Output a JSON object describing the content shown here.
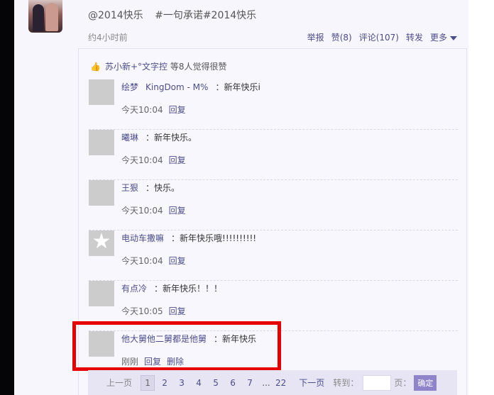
{
  "post": {
    "text_tag1": "@2014快乐",
    "text_tag2": "#一句承诺#2014快乐",
    "time": "约4小时前",
    "actions": {
      "report": "举报",
      "like": "赞(8)",
      "comment": "评论(107)",
      "forward": "转发",
      "more": "更多"
    }
  },
  "likes": {
    "user": "苏小新+°文字控",
    "suffix": " 等8人觉得很赞"
  },
  "comments": [
    {
      "name": "绘梦",
      "name2": "KingDom - M%",
      "text": "：新年快乐i",
      "time": "今天10:04",
      "reply": "回复"
    },
    {
      "name": "曦琳",
      "text": "：新年快乐。",
      "time": "今天10:04",
      "reply": "回复"
    },
    {
      "name": "王狠",
      "text": "：快乐。",
      "time": "今天10:04",
      "reply": "回复"
    },
    {
      "name": "电动车撒嘛",
      "text": "：新年快乐哦!!!!!!!!!!",
      "time": "今天10:04",
      "reply": "回复"
    },
    {
      "name": "有点冷",
      "text": "：新年快乐！！！",
      "time": "今天10:05",
      "reply": "回复"
    },
    {
      "name": "他大舅他二舅都是他舅",
      "text": "：新年快乐",
      "time": "刚刚",
      "reply": "回复",
      "delete": "删除"
    }
  ],
  "pager": {
    "prev": "上一页",
    "pages": [
      "1",
      "2",
      "3",
      "4",
      "5",
      "6",
      "7"
    ],
    "ellipsis": "...",
    "last": "22",
    "next": "下一页",
    "goto": "转到：",
    "unit": "页：",
    "confirm": "确定",
    "input_value": ""
  },
  "icons": [
    "thumbs-up-icon",
    "chevron-down-icon",
    "default-star-icon"
  ],
  "colors": {
    "link": "#4b4d8a",
    "highlight": "#e60000",
    "confirm_button": "#8f84c9"
  }
}
